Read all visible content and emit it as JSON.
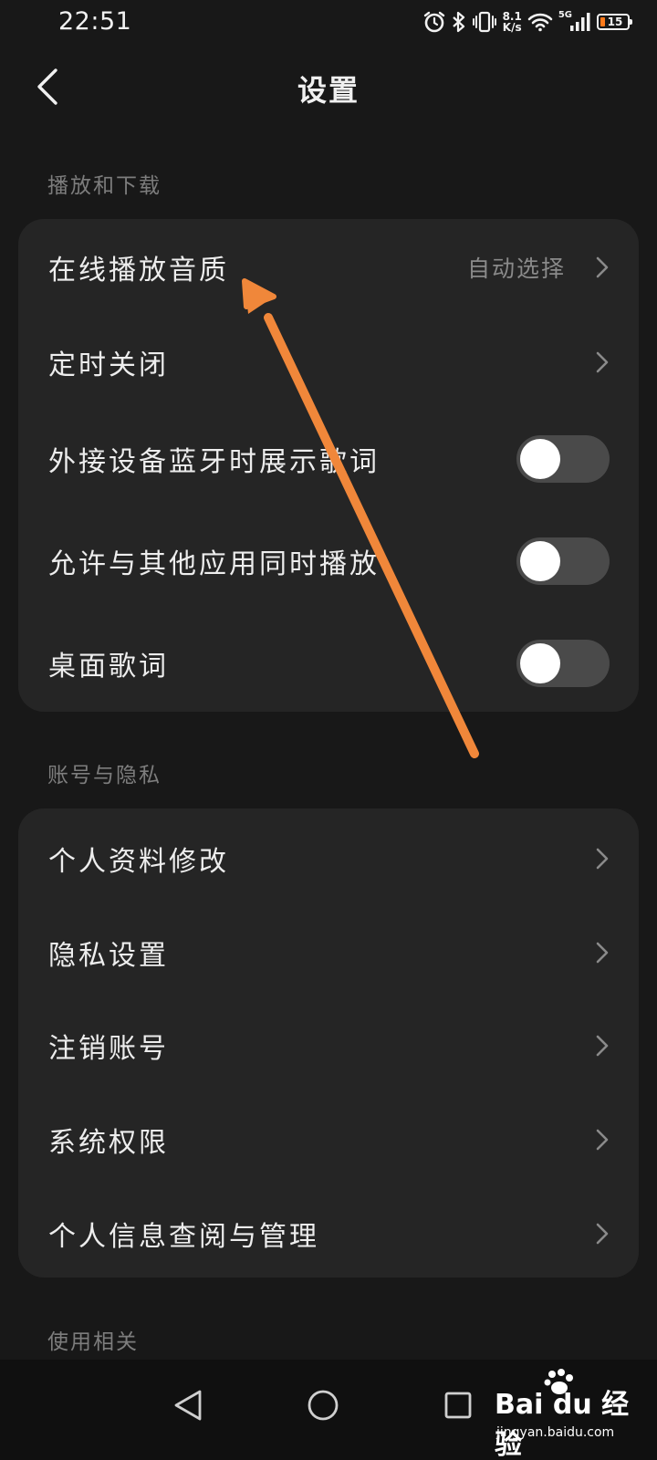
{
  "status_bar": {
    "time": "22:51",
    "net_speed_value": "8.1",
    "net_speed_unit": "K/s",
    "signal_label": "5G",
    "battery_level": "15",
    "battery_color": "#ff7a1a"
  },
  "header": {
    "title": "设置",
    "back_icon": "chevron-left-icon"
  },
  "sections": [
    {
      "title": "播放和下载",
      "items": [
        {
          "label": "在线播放音质",
          "value": "自动选择",
          "control": "chevron"
        },
        {
          "label": "定时关闭",
          "control": "chevron"
        },
        {
          "label": "外接设备蓝牙时展示歌词",
          "control": "toggle",
          "on": false
        },
        {
          "label": "允许与其他应用同时播放",
          "control": "toggle",
          "on": false
        },
        {
          "label": "桌面歌词",
          "control": "toggle",
          "on": false
        }
      ]
    },
    {
      "title": "账号与隐私",
      "items": [
        {
          "label": "个人资料修改",
          "control": "chevron"
        },
        {
          "label": "隐私设置",
          "control": "chevron"
        },
        {
          "label": "注销账号",
          "control": "chevron"
        },
        {
          "label": "系统权限",
          "control": "chevron"
        },
        {
          "label": "个人信息查阅与管理",
          "control": "chevron"
        }
      ]
    },
    {
      "title": "使用相关",
      "items": []
    }
  ],
  "nav_bar": {
    "back_icon": "triangle-back-icon",
    "home_icon": "circle-home-icon",
    "recents_icon": "square-recents-icon"
  },
  "watermark": {
    "logo_text": "Bai du 经验",
    "url": "jingyan.baidu.com"
  },
  "annotation": {
    "color": "#f0873a",
    "icon": "orange-arrow-pointer"
  },
  "colors": {
    "background": "#181818",
    "card": "#252525",
    "section_title": "#7d7d7d",
    "toggle_off_track": "#4a4a4a"
  }
}
